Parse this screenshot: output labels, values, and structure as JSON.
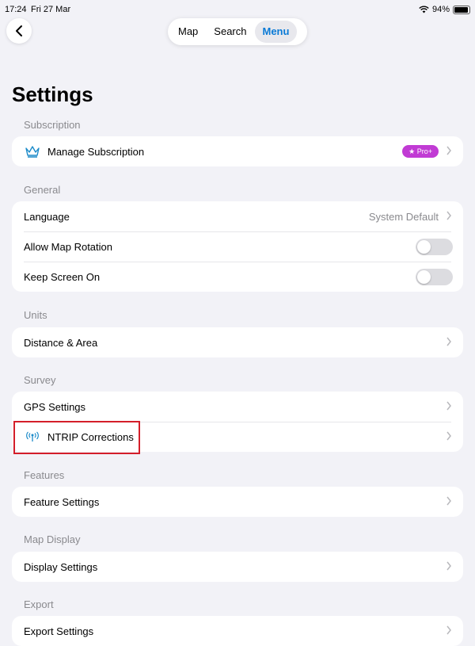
{
  "status_bar": {
    "time": "17:24",
    "date": "Fri 27 Mar",
    "battery_text": "94%",
    "battery_level": 0.94
  },
  "nav": {
    "back_icon": "chevron-left-icon",
    "tabs": [
      {
        "label": "Map",
        "active": false
      },
      {
        "label": "Search",
        "active": false
      },
      {
        "label": "Menu",
        "active": true
      }
    ]
  },
  "page": {
    "title": "Settings"
  },
  "sections": {
    "subscription": {
      "header": "Subscription",
      "items": [
        {
          "label": "Manage Subscription",
          "icon": "crown-icon",
          "badge": "Pro+"
        }
      ]
    },
    "general": {
      "header": "General",
      "items": [
        {
          "label": "Language",
          "value": "System Default"
        },
        {
          "label": "Allow Map Rotation",
          "toggle": false
        },
        {
          "label": "Keep Screen On",
          "toggle": false
        }
      ]
    },
    "units": {
      "header": "Units",
      "items": [
        {
          "label": "Distance & Area"
        }
      ]
    },
    "survey": {
      "header": "Survey",
      "items": [
        {
          "label": "GPS Settings"
        },
        {
          "label": "NTRIP Corrections",
          "icon": "antenna-icon"
        }
      ]
    },
    "features": {
      "header": "Features",
      "items": [
        {
          "label": "Feature Settings"
        }
      ]
    },
    "map_display": {
      "header": "Map Display",
      "items": [
        {
          "label": "Display Settings"
        }
      ]
    },
    "export": {
      "header": "Export",
      "items": [
        {
          "label": "Export Settings"
        }
      ]
    }
  },
  "colors": {
    "accent": "#0a7ad6",
    "badge": "#c13bd4",
    "highlight": "#d41e2a",
    "background": "#f2f2f7"
  }
}
